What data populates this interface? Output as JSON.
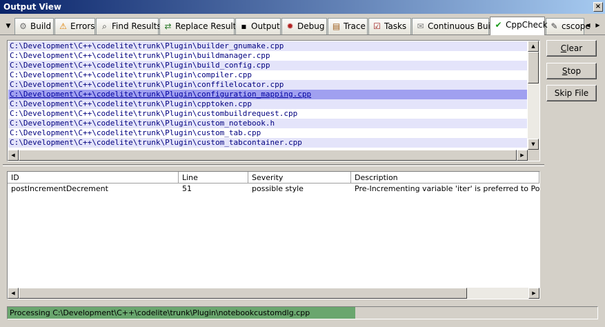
{
  "window": {
    "title": "Output View"
  },
  "tabs": [
    {
      "label": "Build",
      "icon": "gear-icon",
      "glyph": "⚙",
      "color": "#707070"
    },
    {
      "label": "Errors",
      "icon": "warning-icon",
      "glyph": "⚠",
      "color": "#e08000"
    },
    {
      "label": "Find Results",
      "icon": "binoculars-icon",
      "glyph": "⌕",
      "color": "#303030"
    },
    {
      "label": "Replace Results",
      "icon": "replace-icon",
      "glyph": "⇄",
      "color": "#2a7a2a"
    },
    {
      "label": "Output",
      "icon": "console-icon",
      "glyph": "▪",
      "color": "#000000"
    },
    {
      "label": "Debug",
      "icon": "bug-icon",
      "glyph": "✹",
      "color": "#b02020"
    },
    {
      "label": "Trace",
      "icon": "trace-icon",
      "glyph": "▤",
      "color": "#a06020"
    },
    {
      "label": "Tasks",
      "icon": "tasks-icon",
      "glyph": "☑",
      "color": "#a02020"
    },
    {
      "label": "Continuous Build",
      "icon": "mail-icon",
      "glyph": "✉",
      "color": "#808080"
    },
    {
      "label": "CppCheck",
      "icon": "check-icon",
      "glyph": "✔",
      "color": "#1a9a1a"
    },
    {
      "label": "cscope",
      "icon": "tool-icon",
      "glyph": "✎",
      "color": "#404040"
    }
  ],
  "files": [
    "C:\\Development\\C++\\codelite\\trunk\\Plugin\\builder_gnumake.cpp",
    "C:\\Development\\C++\\codelite\\trunk\\Plugin\\buildmanager.cpp",
    "C:\\Development\\C++\\codelite\\trunk\\Plugin\\build_config.cpp",
    "C:\\Development\\C++\\codelite\\trunk\\Plugin\\compiler.cpp",
    "C:\\Development\\C++\\codelite\\trunk\\Plugin\\conffilelocator.cpp",
    "C:\\Development\\C++\\codelite\\trunk\\Plugin\\configuration_mapping.cpp",
    "C:\\Development\\C++\\codelite\\trunk\\Plugin\\cpptoken.cpp",
    "C:\\Development\\C++\\codelite\\trunk\\Plugin\\custombuildrequest.cpp",
    "C:\\Development\\C++\\codelite\\trunk\\Plugin\\custom_notebook.h",
    "C:\\Development\\C++\\codelite\\trunk\\Plugin\\custom_tab.cpp",
    "C:\\Development\\C++\\codelite\\trunk\\Plugin\\custom_tabcontainer.cpp"
  ],
  "buttons": {
    "clear": {
      "accel": "C",
      "rest": "lear"
    },
    "stop": {
      "accel": "S",
      "rest": "top"
    },
    "skip": "Skip File"
  },
  "results": {
    "columns": [
      "ID",
      "Line",
      "Severity",
      "Description"
    ],
    "rows": [
      [
        "postIncrementDecrement",
        "51",
        "possible style",
        "Pre-Incrementing variable 'iter' is preferred to Post-Incrementing"
      ]
    ]
  },
  "status": {
    "text": "Processing C:\\Development\\C++\\codelite\\trunk\\Plugin\\notebookcustomdlg.cpp",
    "progress": 0.59,
    "color": "#6aa66e"
  }
}
